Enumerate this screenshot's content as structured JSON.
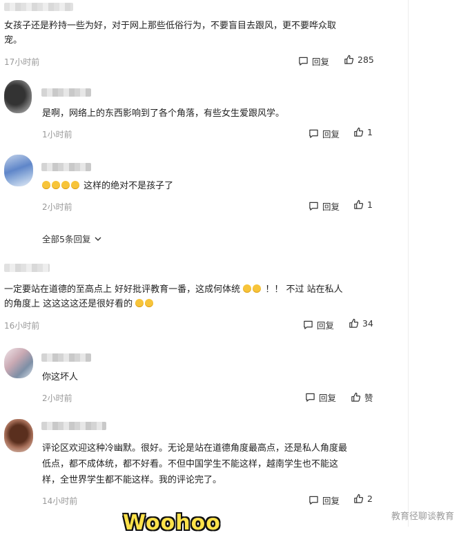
{
  "comments": [
    {
      "text_lines": [
        "女孩子还是矜持一些为好，对于网上那些低俗行为，不要盲目去跟风，更不要哗众取",
        "宠。"
      ],
      "time": "17小时前",
      "reply_label": "回复",
      "likes": "285"
    },
    {
      "text_lines": [
        "是啊，网络上的东西影响到了各个角落，有些女生爱跟风学。"
      ],
      "time": "1小时前",
      "reply_label": "回复",
      "likes": "1"
    },
    {
      "text_lines": [
        "这样的绝对不是孩子了"
      ],
      "emoji_count": 4,
      "time": "2小时前",
      "reply_label": "回复",
      "likes": "1"
    },
    {
      "text_lines": [
        "一定要站在道德的至高点上 好好批评教育一番，这成何体统",
        "！！  不过 站在私人",
        "的角度上 这这这这还是很好看的"
      ],
      "time": "16小时前",
      "reply_label": "回复",
      "likes": "34"
    },
    {
      "text_lines": [
        "你这坏人"
      ],
      "time": "2小时前",
      "reply_label": "回复",
      "likes": "赞"
    },
    {
      "text_lines": [
        "评论区欢迎这种冷幽默。很好。无论是站在道德角度最高点，还是私人角度最",
        "低点，都不成体统，都不好看。不但中国学生不能这样，越南学生也不能这",
        "样，全世界学生都不能这样。我的评论完了。"
      ],
      "time": "14小时前",
      "reply_label": "回复",
      "likes": "2"
    }
  ],
  "expand_replies": "全部5条回复",
  "watermark": "教育径聊谈教育",
  "caption": "Woohoo",
  "colors": {
    "text": "#222222",
    "muted": "#999999",
    "caption": "#ffe24a",
    "emoji": "#f7c43a"
  },
  "icons": [
    "comment-icon",
    "thumbs-up-icon",
    "chevron-down-icon"
  ]
}
